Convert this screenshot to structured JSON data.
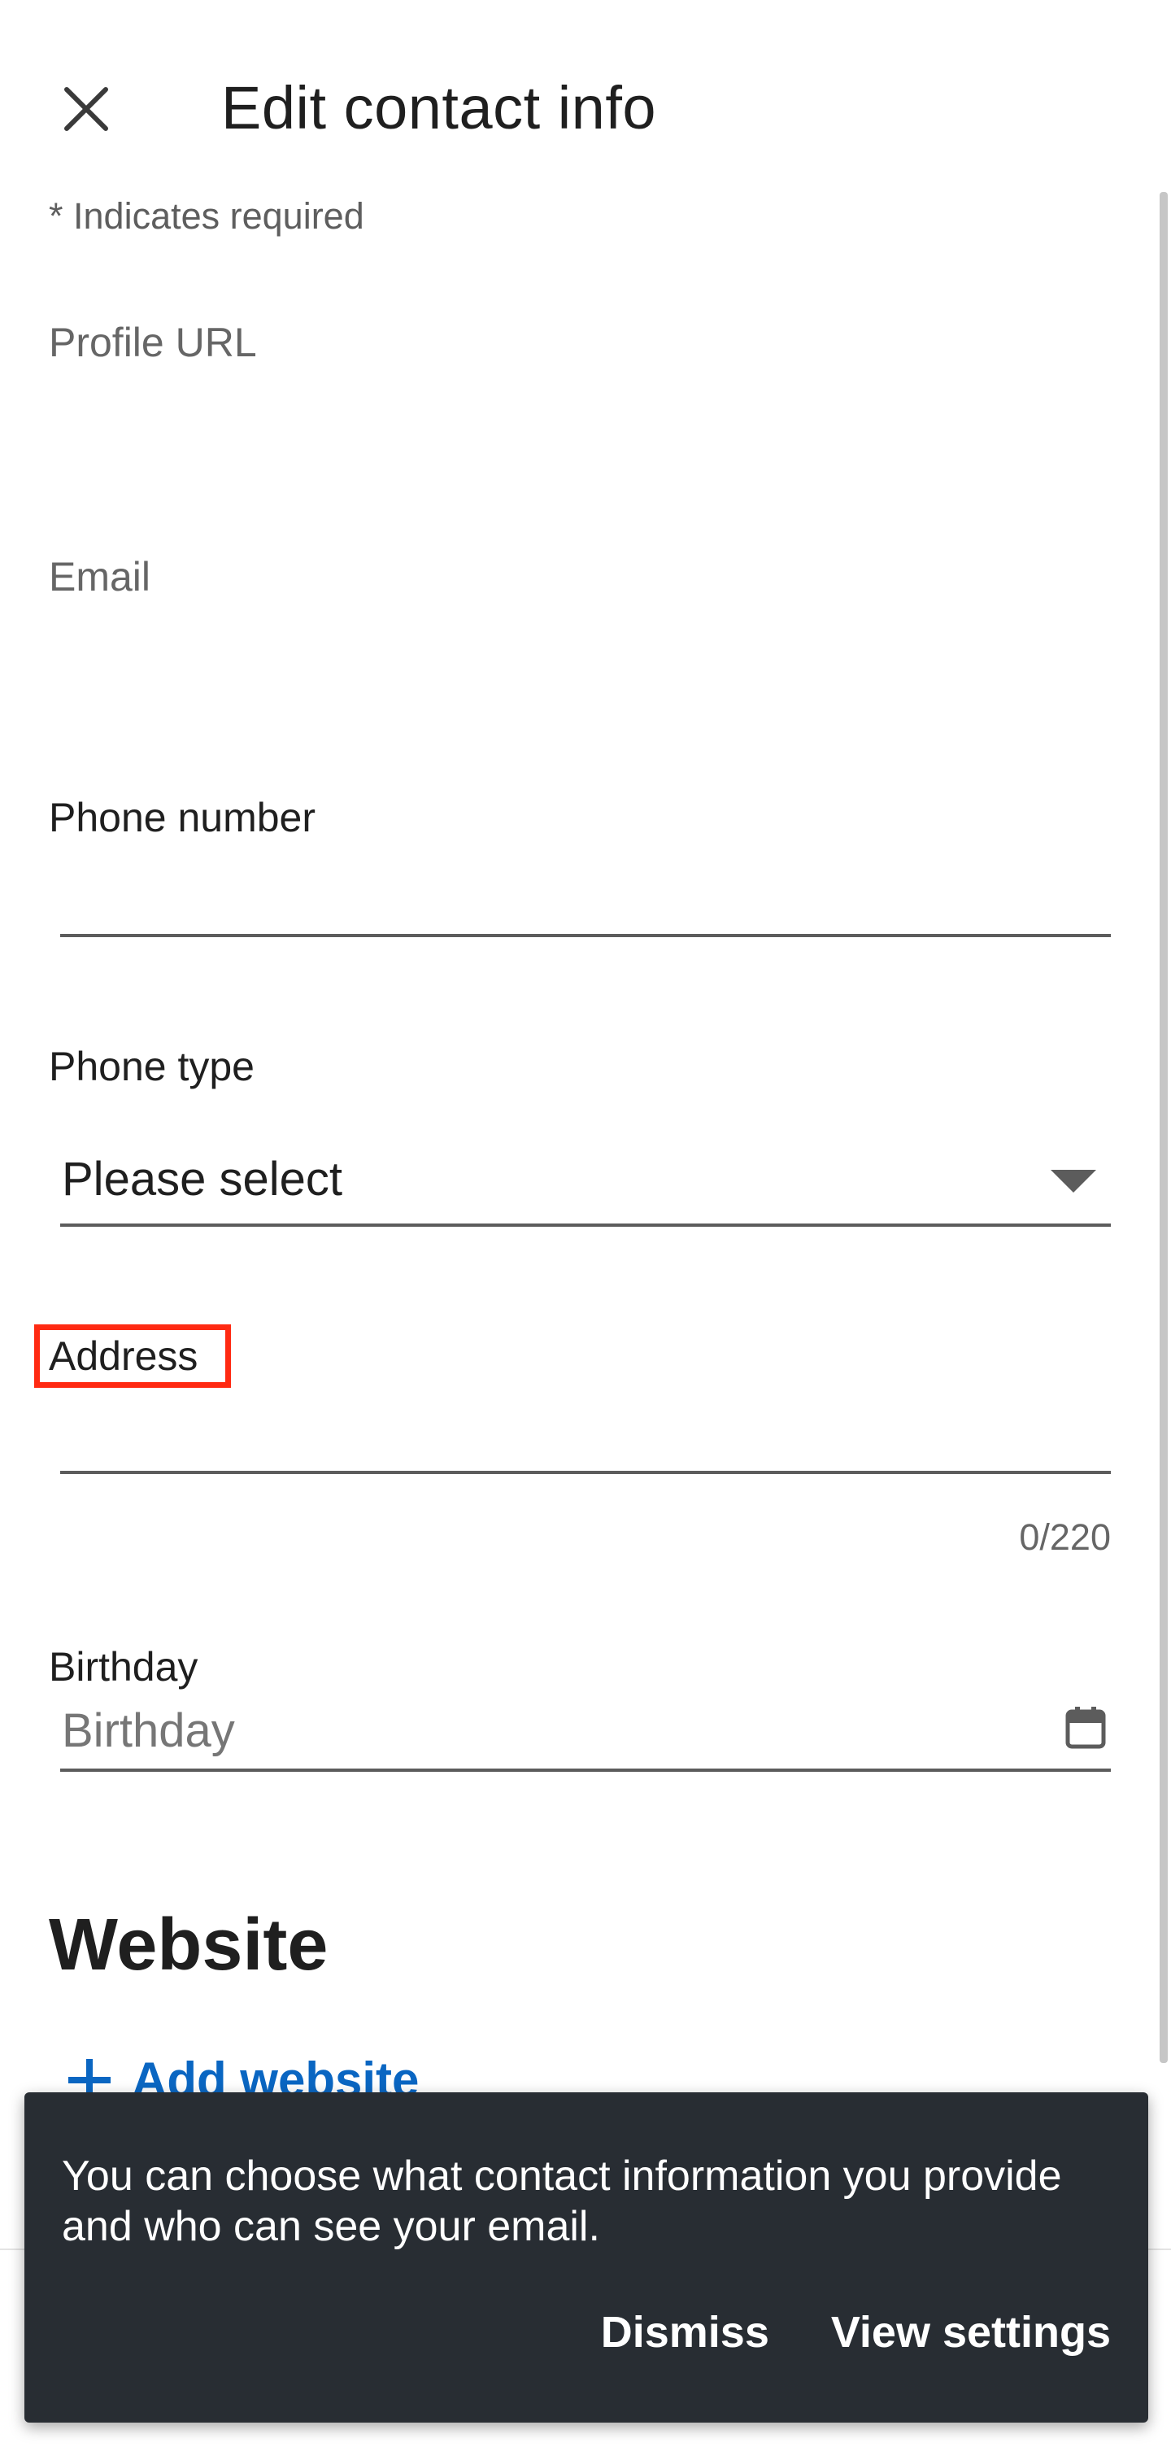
{
  "header": {
    "title": "Edit contact info",
    "close_icon": "close-icon"
  },
  "form": {
    "required_note": "* Indicates required",
    "profile_url_label": "Profile URL",
    "email_label": "Email",
    "phone_number_label": "Phone number",
    "phone_number_value": "",
    "phone_type_label": "Phone type",
    "phone_type_value": "Please select",
    "address_label": "Address",
    "address_value": "",
    "address_char_count": "0/220",
    "birthday_label": "Birthday",
    "birthday_placeholder": "Birthday",
    "birthday_icon": "calendar-icon"
  },
  "website": {
    "section_title": "Website",
    "add_label": "Add website"
  },
  "snackbar": {
    "message": "You can choose what contact information you provide and who can see your email.",
    "dismiss_label": "Dismiss",
    "view_settings_label": "View settings"
  },
  "colors": {
    "accent": "#0a66c2",
    "snackbar_bg": "#282d33",
    "highlight": "#ff2a12"
  }
}
